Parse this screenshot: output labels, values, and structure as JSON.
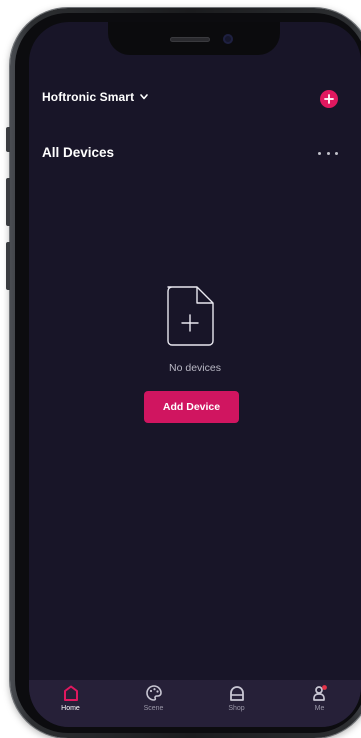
{
  "header": {
    "home_name": "Hoftronic Smart",
    "home_dropdown_icon": "chevron-down-icon",
    "add_icon": "plus-circle-icon"
  },
  "devices_section": {
    "title": "All Devices",
    "menu_icon": "more-horizontal-icon"
  },
  "empty_state": {
    "icon": "document-plus-icon",
    "message": "No devices",
    "button_label": "Add Device"
  },
  "tabbar": {
    "tabs": [
      {
        "label": "Home",
        "icon": "home-icon",
        "active": true
      },
      {
        "label": "Scene",
        "icon": "palette-icon",
        "active": false
      },
      {
        "label": "Shop",
        "icon": "shop-icon",
        "active": false
      },
      {
        "label": "Me",
        "icon": "person-icon",
        "active": false
      }
    ]
  },
  "colors": {
    "accent": "#d01560",
    "screen_bg": "#181528",
    "tabbar_bg": "#262038"
  }
}
